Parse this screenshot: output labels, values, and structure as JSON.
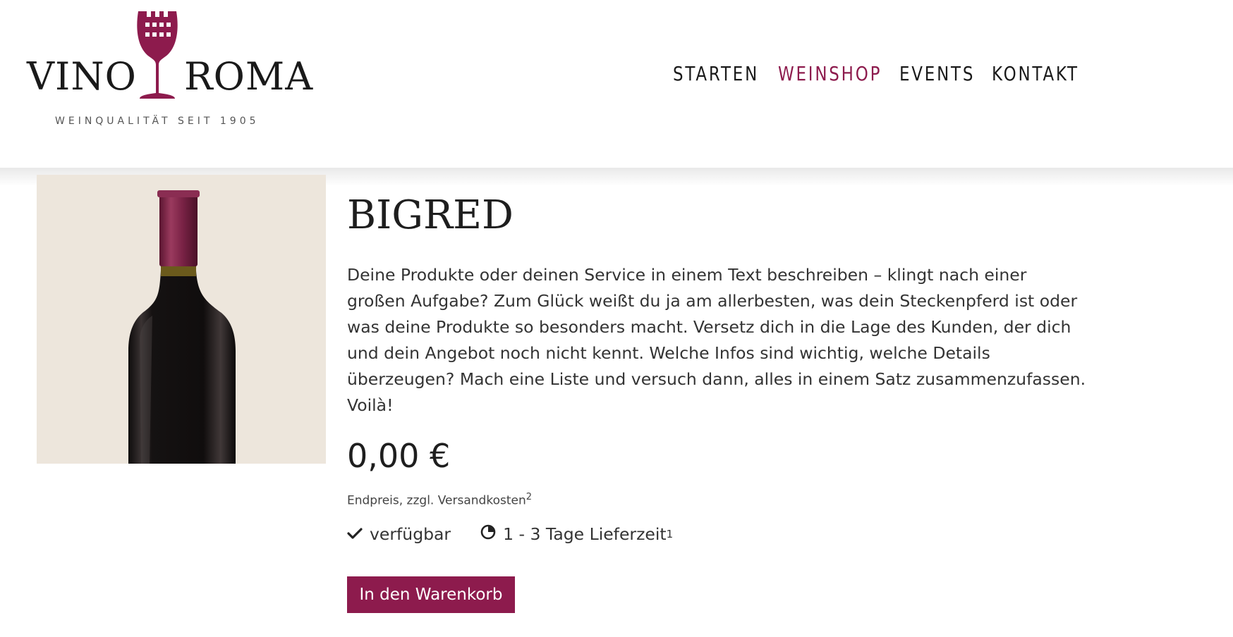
{
  "logo": {
    "word_left": "VINO",
    "word_right": "ROMA",
    "tagline": "WEINQUALITÄT SEIT 1905",
    "icon": "wine-glass-icon"
  },
  "nav": {
    "items": [
      {
        "label": "STARTEN",
        "active": false
      },
      {
        "label": "WEINSHOP",
        "active": true
      },
      {
        "label": "EVENTS",
        "active": false
      },
      {
        "label": "KONTAKT",
        "active": false
      }
    ]
  },
  "product": {
    "title": "BIGRED",
    "description": "Deine Produkte oder deinen Service in einem Text beschreiben – klingt nach einer großen Aufgabe? Zum Glück weißt du ja am allerbesten, was dein Steckenpferd ist oder was deine Produkte so besonders macht. Versetz dich in die Lage des Kunden, der dich und dein Angebot noch nicht kennt. Welche Infos sind wichtig, welche Details überzeugen? Mach eine Liste und versuch dann, alles in einem Satz zusammenzufassen. Voilà!",
    "price": "0,00 €",
    "price_note_main": "Endpreis, zzgl. Versandkosten",
    "price_note_sup": "2",
    "availability": "verfügbar",
    "delivery": "1 - 3 Tage Lieferzeit",
    "delivery_sup": "1",
    "cart_label": "In den Warenkorb"
  },
  "colors": {
    "accent": "#8d1b4d",
    "image_bg": "#ede6dc"
  },
  "icons": {
    "availability": "checkmark-icon",
    "delivery": "clock-icon"
  }
}
